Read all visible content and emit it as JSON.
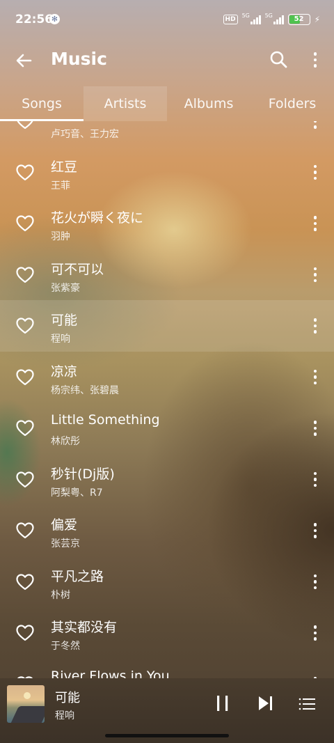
{
  "status_bar": {
    "time": "22:56",
    "hd_label": "HD",
    "network_1": "5G",
    "network_2": "5G",
    "battery": "52"
  },
  "app_bar": {
    "title": "Music"
  },
  "tabs": [
    {
      "label": "Songs",
      "active": true
    },
    {
      "label": "Artists",
      "active": false
    },
    {
      "label": "Albums",
      "active": false
    },
    {
      "label": "Folders",
      "active": false
    }
  ],
  "songs": [
    {
      "title": "",
      "artist": "卢巧音、王力宏"
    },
    {
      "title": "红豆",
      "artist": "王菲"
    },
    {
      "title": "花火が瞬く夜に",
      "artist": "羽肿"
    },
    {
      "title": "可不可以",
      "artist": "张紫豪"
    },
    {
      "title": "可能",
      "artist": "程响"
    },
    {
      "title": "凉凉",
      "artist": "杨宗纬、张碧晨"
    },
    {
      "title": "Little Something",
      "artist": "林欣彤"
    },
    {
      "title": "秒针(Dj版)",
      "artist": "阿梨粤、R7"
    },
    {
      "title": "偏爱",
      "artist": "张芸京"
    },
    {
      "title": "平凡之路",
      "artist": "朴树"
    },
    {
      "title": "其实都没有",
      "artist": "于冬然"
    },
    {
      "title": "River Flows in You",
      "artist": ""
    }
  ],
  "now_playing": {
    "title": "可能",
    "artist": "程响"
  }
}
